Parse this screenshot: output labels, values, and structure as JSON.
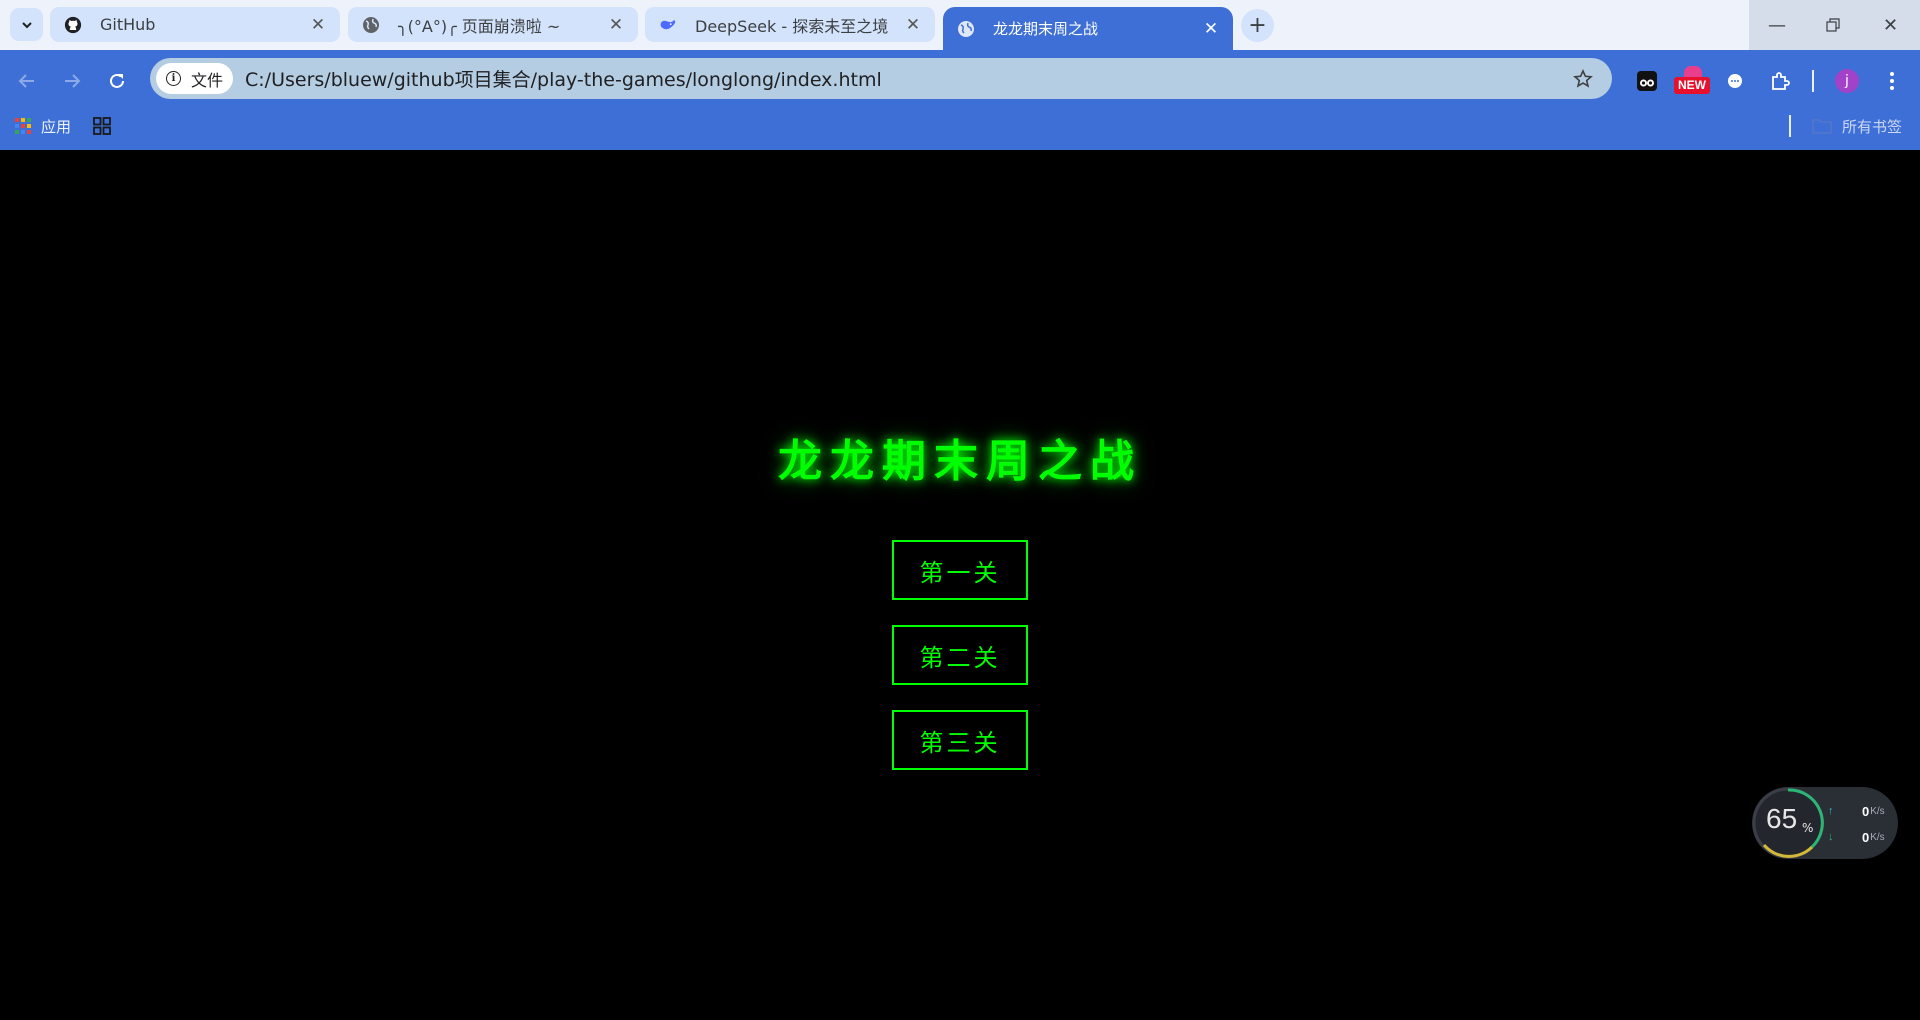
{
  "browser": {
    "tabs": [
      {
        "title": "GitHub",
        "icon": "github-icon"
      },
      {
        "title": "╮(°A°)╭ 页面崩溃啦 ~",
        "icon": "globe-icon"
      },
      {
        "title": "DeepSeek - 探索未至之境",
        "icon": "deepseek-whale-icon"
      },
      {
        "title": "龙龙期末周之战",
        "icon": "globe-icon",
        "active": true
      }
    ],
    "address_chip": "文件",
    "url": "C:/Users/bluew/github项目集合/play-the-games/longlong/index.html",
    "extension_badge": "NEW",
    "profile_initial": "j",
    "bookmarks": {
      "apps_label": "应用",
      "all_bookmarks_label": "所有书签"
    },
    "accent_color": "#3d6fd6"
  },
  "game": {
    "title": "龙龙期末周之战",
    "levels": [
      "第一关",
      "第二关",
      "第三关"
    ],
    "color": "#00ff00"
  },
  "net_widget": {
    "cpu_percent": "65",
    "percent_sign": "%",
    "upload": "0",
    "download": "0",
    "unit": "K/s"
  }
}
